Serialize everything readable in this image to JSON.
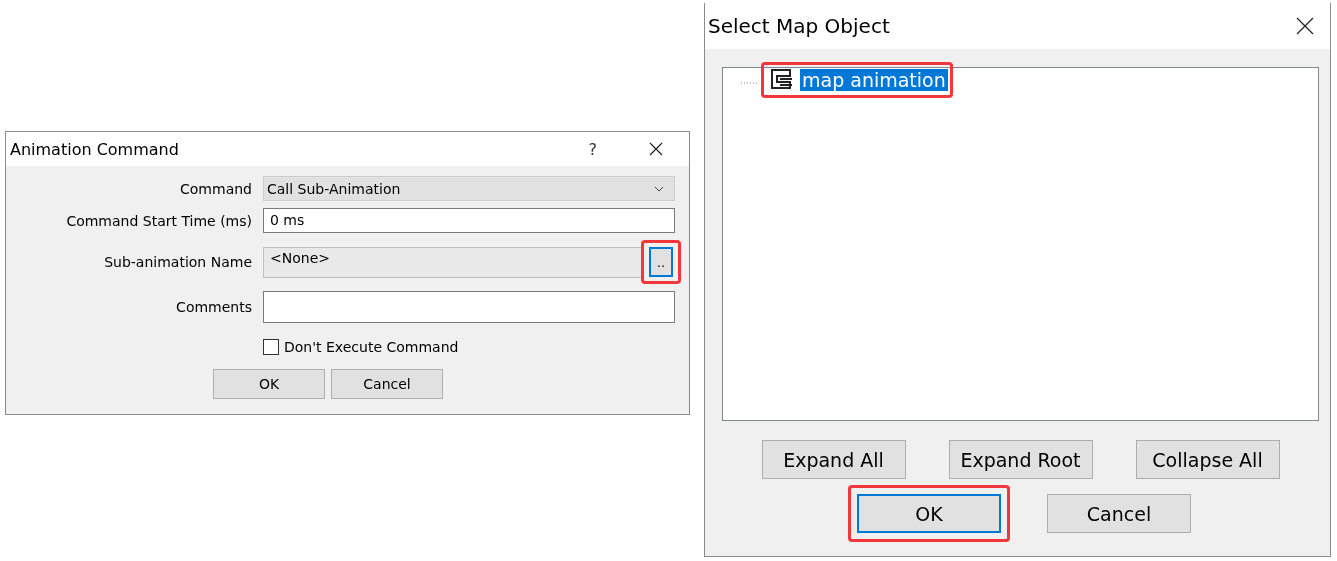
{
  "animation_command_dialog": {
    "title": "Animation Command",
    "help": "?",
    "fields": [
      {
        "label": "Command",
        "kind": "dropdown",
        "value": "Call Sub-Animation"
      },
      {
        "label": "Command Start Time (ms)",
        "kind": "text",
        "value": "0 ms"
      },
      {
        "label": "Sub-animation Name",
        "kind": "browse",
        "value": "<None>",
        "button": {
          "label": "..",
          "focused": true,
          "highlighted": true
        }
      },
      {
        "label": "Comments",
        "kind": "text"
      }
    ],
    "checkbox": {
      "label": "Don't Execute Command",
      "checked": false
    },
    "buttons": [
      {
        "label": "OK",
        "focused": false,
        "highlighted": false
      },
      {
        "label": "Cancel",
        "focused": false,
        "highlighted": false
      }
    ]
  },
  "select_map_object_dialog": {
    "title": "Select Map Object",
    "tree": [
      {
        "label": "map animation",
        "selected": true,
        "highlighted": true
      }
    ],
    "tree_buttons": [
      {
        "label": "Expand All"
      },
      {
        "label": "Expand Root"
      },
      {
        "label": "Collapse All"
      }
    ],
    "buttons": [
      {
        "label": "OK",
        "focused": true,
        "highlighted": true
      },
      {
        "label": "Cancel",
        "focused": false,
        "highlighted": false
      }
    ]
  }
}
